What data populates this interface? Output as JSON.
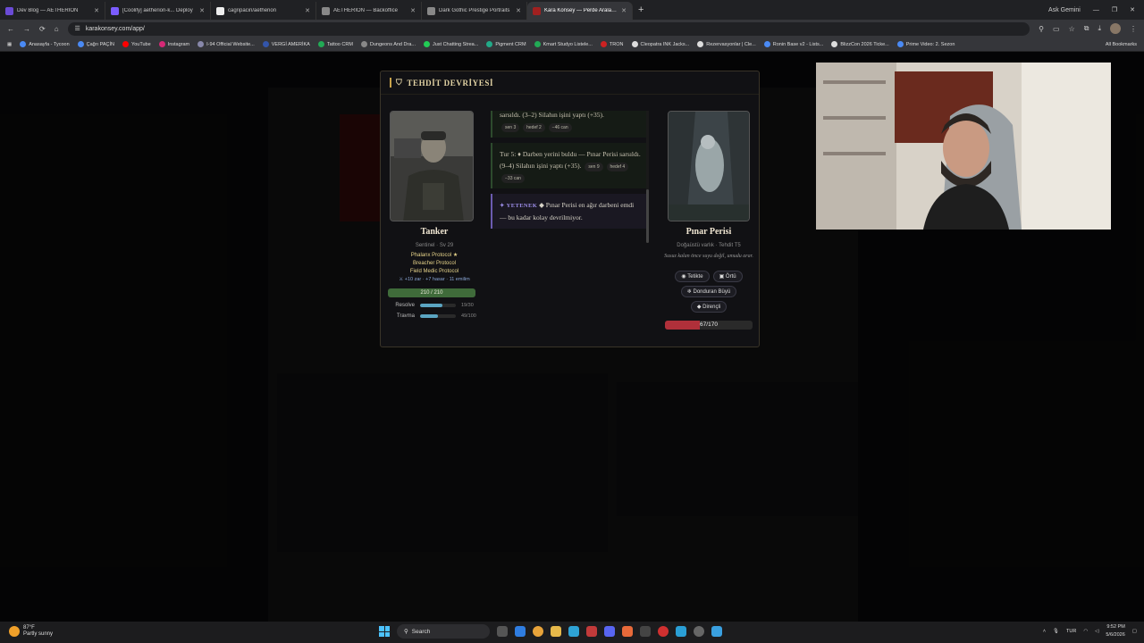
{
  "browser": {
    "tabs": [
      {
        "title": "Dev Blog — AETHERION",
        "color": "#6b4bd6"
      },
      {
        "title": "[Coolify] aetherion-k... Deploy",
        "color": "#7b5cff"
      },
      {
        "title": "cagripacin/aetherion",
        "color": "#eeeeee"
      },
      {
        "title": "AETHERION — Backoffice",
        "color": "#888888"
      },
      {
        "title": "Dark Gothic Prestige Portraits",
        "color": "#888888"
      },
      {
        "title": "Kara Konsey — Perde Aralandı",
        "color": "#a02020",
        "active": true
      }
    ],
    "new_tab": "+",
    "profile_label": "Ask Gemini",
    "url": "karakonsey.com/app/",
    "bookmarks": [
      {
        "label": "Anasayfa - Tycoon",
        "color": "#4a8af4"
      },
      {
        "label": "Çağrı PAÇİN",
        "color": "#4a8af4"
      },
      {
        "label": "YouTube",
        "color": "#ff0000"
      },
      {
        "label": "Instagram",
        "color": "#d62976"
      },
      {
        "label": "I-94 Official Website...",
        "color": "#8888aa"
      },
      {
        "label": "VERGİ AMERİKA",
        "color": "#3355aa"
      },
      {
        "label": "Tattoo CRM",
        "color": "#22aa55"
      },
      {
        "label": "Dungeons And Dra...",
        "color": "#888888"
      },
      {
        "label": "Just Chatting Strea...",
        "color": "#22cc55"
      },
      {
        "label": "Pigment CRM",
        "color": "#22aa88"
      },
      {
        "label": "Kmart Studyo Listele...",
        "color": "#22aa55"
      },
      {
        "label": "TRON",
        "color": "#cc2222"
      },
      {
        "label": "Cleopatra INK Jacks...",
        "color": "#dddddd"
      },
      {
        "label": "Rezervasyonlar | Cle...",
        "color": "#dddddd"
      },
      {
        "label": "Ronin Base v2 - Lists...",
        "color": "#4a8af4"
      },
      {
        "label": "BlizzCon 2026 Ticke...",
        "color": "#dddddd"
      },
      {
        "label": "Prime Video: 2. Sezon",
        "color": "#4a8af4"
      }
    ],
    "all_bookmarks": "All Bookmarks"
  },
  "modal": {
    "title": "TEHDİT DEVRİYESİ",
    "player": {
      "name": "Tanker",
      "subtitle": "Sentinel · Sv 29",
      "protocols": [
        "Phalanx Protocol ★",
        "Breacher Protocol",
        "Field Medic Protocol"
      ],
      "stats": "⚔ +10 zar · +7 hasar · 11 emilim",
      "hp_text": "210 / 210",
      "hp_fraction": 1.0,
      "metrics": [
        {
          "label": "Resolve",
          "value": "19/30",
          "fraction": 0.63
        },
        {
          "label": "Travma",
          "value": "49/100",
          "fraction": 0.49
        }
      ]
    },
    "log": [
      {
        "text": "sarsıldı. (3–2) Silahın işini yaptı (+35).",
        "chips": [
          "sen 3",
          "hedef 2",
          "−46 can"
        ]
      },
      {
        "text": "Tur 5: ♦ Darben yerini buldu — Pınar Perisi sarsıldı. (9–4) Silahın işini yaptı (+35).",
        "chips": [
          "sen 9",
          "hedef 4",
          "−33 can"
        ]
      }
    ],
    "ability": {
      "tag": "✦ YETENEK",
      "text": "◆ Pınar Perisi en ağır darbeni emdi — bu kadar kolay devrilmiyor."
    },
    "enemy": {
      "name": "Pınar Perisi",
      "subtitle": "Doğaüstü varlık · Tehdit T5",
      "quote": "Susuz kalan önce suyu değil, umudu arar.",
      "badges": [
        "◉ Tetikte",
        "▣ Örtü",
        "❄ Donduran Büyü",
        "◆ Dirençli"
      ],
      "hp_text": "67/170",
      "hp_fraction": 0.394
    }
  },
  "taskbar": {
    "weather_temp": "87°F",
    "weather_desc": "Partly sunny",
    "search_placeholder": "Search",
    "lang": "TUR",
    "time": "9:52 PM",
    "date": "5/6/2026"
  }
}
